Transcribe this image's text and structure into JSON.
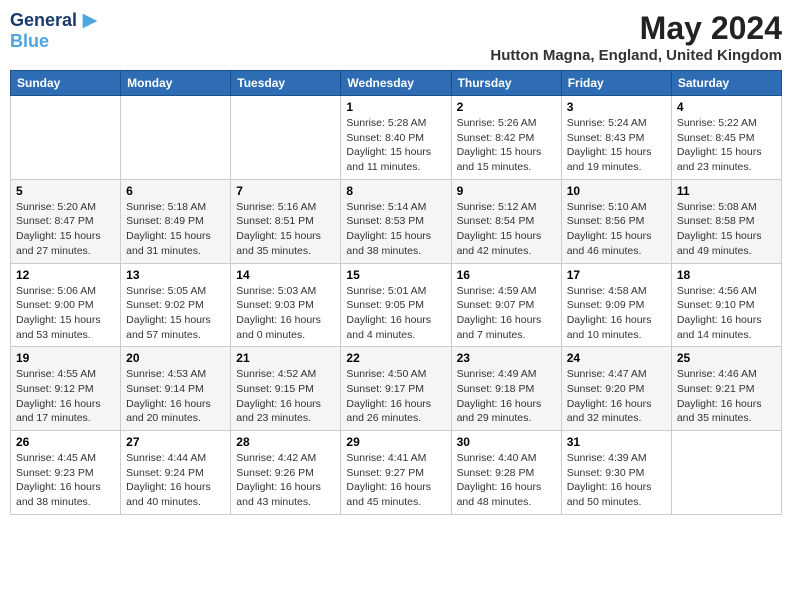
{
  "logo": {
    "line1": "General",
    "line2": "Blue",
    "icon": "▶"
  },
  "title": "May 2024",
  "location": "Hutton Magna, England, United Kingdom",
  "days_of_week": [
    "Sunday",
    "Monday",
    "Tuesday",
    "Wednesday",
    "Thursday",
    "Friday",
    "Saturday"
  ],
  "weeks": [
    [
      {
        "day": "",
        "info": ""
      },
      {
        "day": "",
        "info": ""
      },
      {
        "day": "",
        "info": ""
      },
      {
        "day": "1",
        "info": "Sunrise: 5:28 AM\nSunset: 8:40 PM\nDaylight: 15 hours and 11 minutes."
      },
      {
        "day": "2",
        "info": "Sunrise: 5:26 AM\nSunset: 8:42 PM\nDaylight: 15 hours and 15 minutes."
      },
      {
        "day": "3",
        "info": "Sunrise: 5:24 AM\nSunset: 8:43 PM\nDaylight: 15 hours and 19 minutes."
      },
      {
        "day": "4",
        "info": "Sunrise: 5:22 AM\nSunset: 8:45 PM\nDaylight: 15 hours and 23 minutes."
      }
    ],
    [
      {
        "day": "5",
        "info": "Sunrise: 5:20 AM\nSunset: 8:47 PM\nDaylight: 15 hours and 27 minutes."
      },
      {
        "day": "6",
        "info": "Sunrise: 5:18 AM\nSunset: 8:49 PM\nDaylight: 15 hours and 31 minutes."
      },
      {
        "day": "7",
        "info": "Sunrise: 5:16 AM\nSunset: 8:51 PM\nDaylight: 15 hours and 35 minutes."
      },
      {
        "day": "8",
        "info": "Sunrise: 5:14 AM\nSunset: 8:53 PM\nDaylight: 15 hours and 38 minutes."
      },
      {
        "day": "9",
        "info": "Sunrise: 5:12 AM\nSunset: 8:54 PM\nDaylight: 15 hours and 42 minutes."
      },
      {
        "day": "10",
        "info": "Sunrise: 5:10 AM\nSunset: 8:56 PM\nDaylight: 15 hours and 46 minutes."
      },
      {
        "day": "11",
        "info": "Sunrise: 5:08 AM\nSunset: 8:58 PM\nDaylight: 15 hours and 49 minutes."
      }
    ],
    [
      {
        "day": "12",
        "info": "Sunrise: 5:06 AM\nSunset: 9:00 PM\nDaylight: 15 hours and 53 minutes."
      },
      {
        "day": "13",
        "info": "Sunrise: 5:05 AM\nSunset: 9:02 PM\nDaylight: 15 hours and 57 minutes."
      },
      {
        "day": "14",
        "info": "Sunrise: 5:03 AM\nSunset: 9:03 PM\nDaylight: 16 hours and 0 minutes."
      },
      {
        "day": "15",
        "info": "Sunrise: 5:01 AM\nSunset: 9:05 PM\nDaylight: 16 hours and 4 minutes."
      },
      {
        "day": "16",
        "info": "Sunrise: 4:59 AM\nSunset: 9:07 PM\nDaylight: 16 hours and 7 minutes."
      },
      {
        "day": "17",
        "info": "Sunrise: 4:58 AM\nSunset: 9:09 PM\nDaylight: 16 hours and 10 minutes."
      },
      {
        "day": "18",
        "info": "Sunrise: 4:56 AM\nSunset: 9:10 PM\nDaylight: 16 hours and 14 minutes."
      }
    ],
    [
      {
        "day": "19",
        "info": "Sunrise: 4:55 AM\nSunset: 9:12 PM\nDaylight: 16 hours and 17 minutes."
      },
      {
        "day": "20",
        "info": "Sunrise: 4:53 AM\nSunset: 9:14 PM\nDaylight: 16 hours and 20 minutes."
      },
      {
        "day": "21",
        "info": "Sunrise: 4:52 AM\nSunset: 9:15 PM\nDaylight: 16 hours and 23 minutes."
      },
      {
        "day": "22",
        "info": "Sunrise: 4:50 AM\nSunset: 9:17 PM\nDaylight: 16 hours and 26 minutes."
      },
      {
        "day": "23",
        "info": "Sunrise: 4:49 AM\nSunset: 9:18 PM\nDaylight: 16 hours and 29 minutes."
      },
      {
        "day": "24",
        "info": "Sunrise: 4:47 AM\nSunset: 9:20 PM\nDaylight: 16 hours and 32 minutes."
      },
      {
        "day": "25",
        "info": "Sunrise: 4:46 AM\nSunset: 9:21 PM\nDaylight: 16 hours and 35 minutes."
      }
    ],
    [
      {
        "day": "26",
        "info": "Sunrise: 4:45 AM\nSunset: 9:23 PM\nDaylight: 16 hours and 38 minutes."
      },
      {
        "day": "27",
        "info": "Sunrise: 4:44 AM\nSunset: 9:24 PM\nDaylight: 16 hours and 40 minutes."
      },
      {
        "day": "28",
        "info": "Sunrise: 4:42 AM\nSunset: 9:26 PM\nDaylight: 16 hours and 43 minutes."
      },
      {
        "day": "29",
        "info": "Sunrise: 4:41 AM\nSunset: 9:27 PM\nDaylight: 16 hours and 45 minutes."
      },
      {
        "day": "30",
        "info": "Sunrise: 4:40 AM\nSunset: 9:28 PM\nDaylight: 16 hours and 48 minutes."
      },
      {
        "day": "31",
        "info": "Sunrise: 4:39 AM\nSunset: 9:30 PM\nDaylight: 16 hours and 50 minutes."
      },
      {
        "day": "",
        "info": ""
      }
    ]
  ]
}
